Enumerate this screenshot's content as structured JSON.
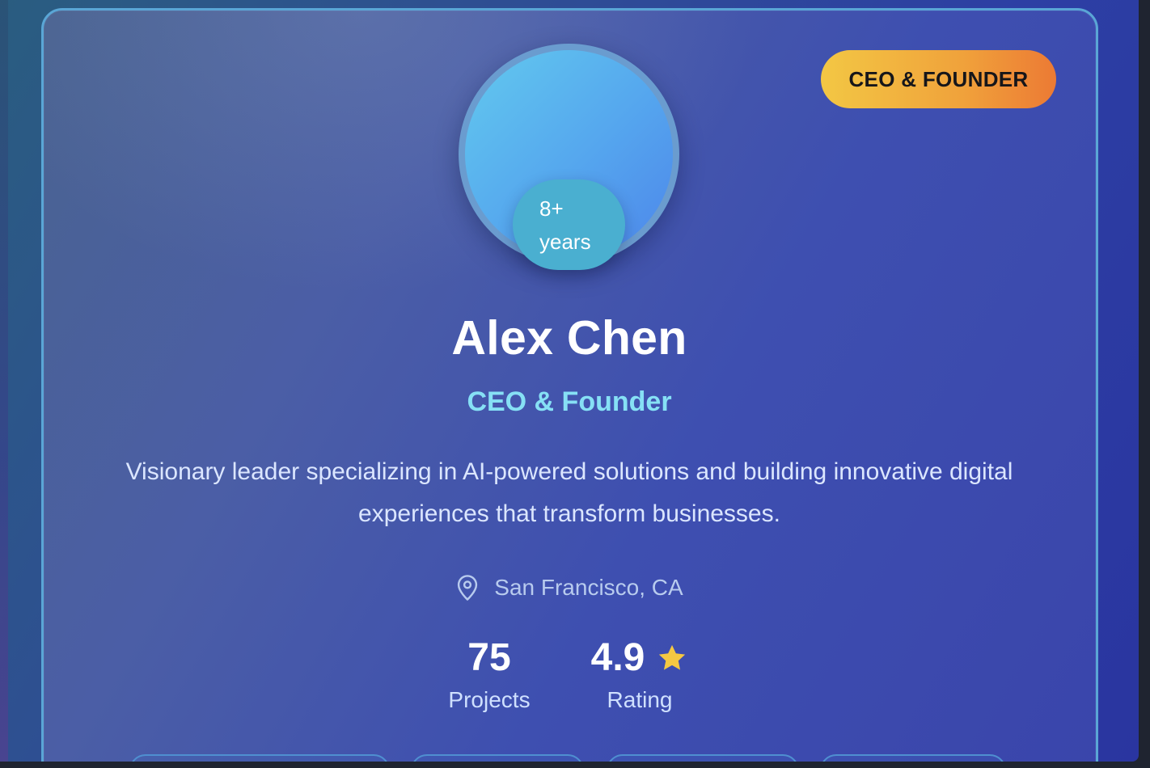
{
  "badge": {
    "label": "CEO & FOUNDER"
  },
  "avatar": {
    "experience_line1": "8+",
    "experience_line2": "years"
  },
  "profile": {
    "name": "Alex Chen",
    "role": "CEO & Founder",
    "bio": "Visionary leader specializing in AI-powered solutions and building innovative digital experiences that transform businesses.",
    "location": "San Francisco, CA"
  },
  "stats": {
    "projects": {
      "value": "75",
      "label": "Projects"
    },
    "rating": {
      "value": "4.9",
      "label": "Rating",
      "icon": "star-icon"
    }
  },
  "colors": {
    "accent": "#86e0f5",
    "badge_gradient_start": "#f3c744",
    "badge_gradient_end": "#ec7a34",
    "star": "#f5c842"
  }
}
